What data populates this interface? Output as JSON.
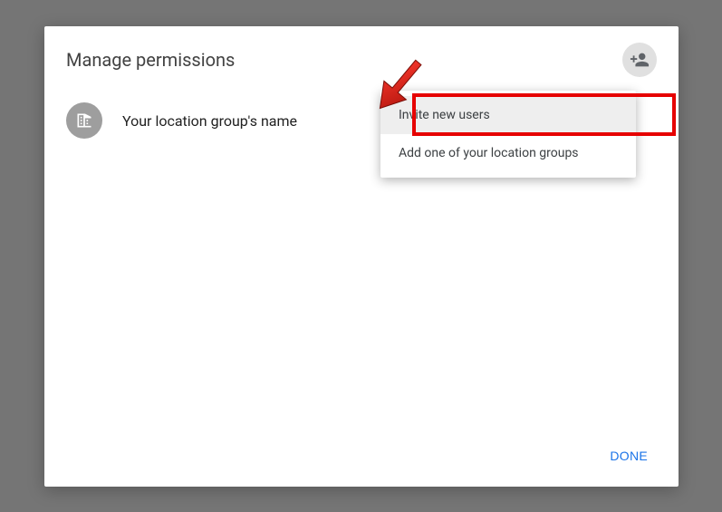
{
  "dialog": {
    "title": "Manage permissions",
    "done_label": "DONE"
  },
  "group": {
    "name": "Your location group's name"
  },
  "menu": {
    "invite_label": "Invite new users",
    "add_group_label": "Add one of your location groups"
  }
}
